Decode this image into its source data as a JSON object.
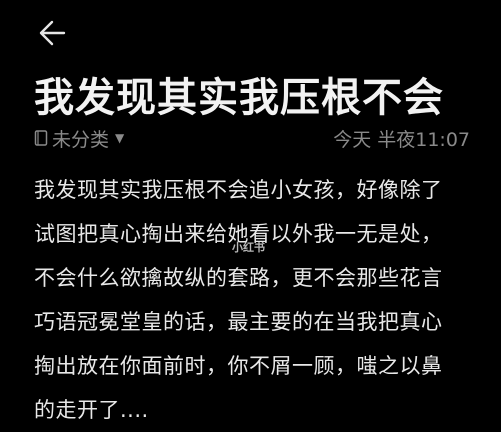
{
  "header": {
    "back_icon": "arrow-left-icon"
  },
  "note": {
    "title": "我发现其实我压根不会",
    "folder_label": "未分类",
    "timestamp": "今天 半夜11:07",
    "body_lines": [
      "我发现其实我压根不会追小女孩，好像除了",
      "试图把真心掏出来给她看以外我一无是处，",
      "不会什么欲擒故纵的套路，更不会那些花言",
      "巧语冠冕堂皇的话，最主要的在当我把真心",
      "掏出放在你面前时，你不屑一顾，嗤之以鼻",
      "的走开了...."
    ]
  },
  "watermark": {
    "text": "小红书"
  },
  "colors": {
    "background": "#000000",
    "title": "#f2f2f2",
    "body_text": "#e8e8e8",
    "meta_text": "#8a8a8a"
  }
}
